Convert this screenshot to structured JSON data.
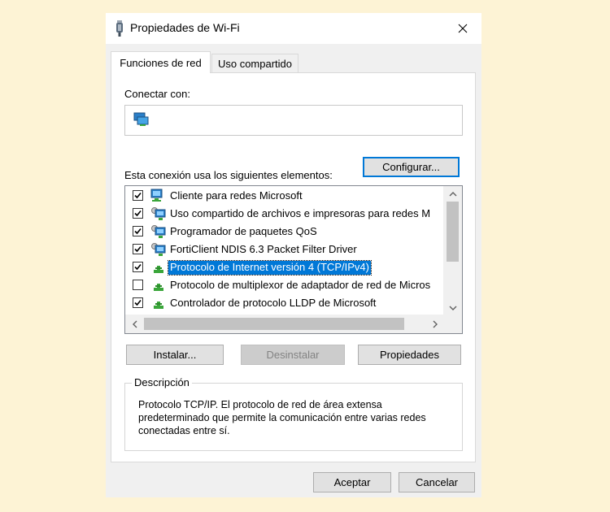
{
  "window": {
    "title": "Propiedades de Wi-Fi",
    "title_icon": "wifi-adapter-icon",
    "close_icon": "close-icon"
  },
  "tabs": [
    {
      "label": "Funciones de red",
      "active": true
    },
    {
      "label": "Uso compartido",
      "active": false
    }
  ],
  "connect": {
    "label": "Conectar con:",
    "adapter_icon": "network-adapter-icon",
    "configure_button": "Configurar..."
  },
  "items_section": {
    "label": "Esta conexión usa los siguientes elementos:",
    "items": [
      {
        "label": "Cliente para redes Microsoft",
        "checked": true,
        "icon": "network-client-icon",
        "selected": false
      },
      {
        "label": "Uso compartido de archivos e impresoras para redes M",
        "checked": true,
        "icon": "network-service-icon",
        "selected": false
      },
      {
        "label": "Programador de paquetes QoS",
        "checked": true,
        "icon": "network-service-icon",
        "selected": false
      },
      {
        "label": "FortiClient NDIS 6.3 Packet Filter Driver",
        "checked": true,
        "icon": "network-service-icon",
        "selected": false
      },
      {
        "label": "Protocolo de Internet versión 4 (TCP/IPv4)",
        "checked": true,
        "icon": "network-protocol-icon",
        "selected": true
      },
      {
        "label": "Protocolo de multiplexor de adaptador de red de Micros",
        "checked": false,
        "icon": "network-protocol-icon",
        "selected": false
      },
      {
        "label": "Controlador de protocolo LLDP de Microsoft",
        "checked": true,
        "icon": "network-protocol-icon",
        "selected": false
      }
    ]
  },
  "actions": {
    "install": "Instalar...",
    "uninstall": "Desinstalar",
    "properties": "Propiedades"
  },
  "description": {
    "legend": "Descripción",
    "text": "Protocolo TCP/IP. El protocolo de red de área extensa predeterminado que permite la comunicación entre varias redes conectadas entre sí."
  },
  "footer": {
    "ok": "Aceptar",
    "cancel": "Cancelar"
  },
  "colors": {
    "accent": "#0078d7",
    "background": "#fdf3d5"
  }
}
